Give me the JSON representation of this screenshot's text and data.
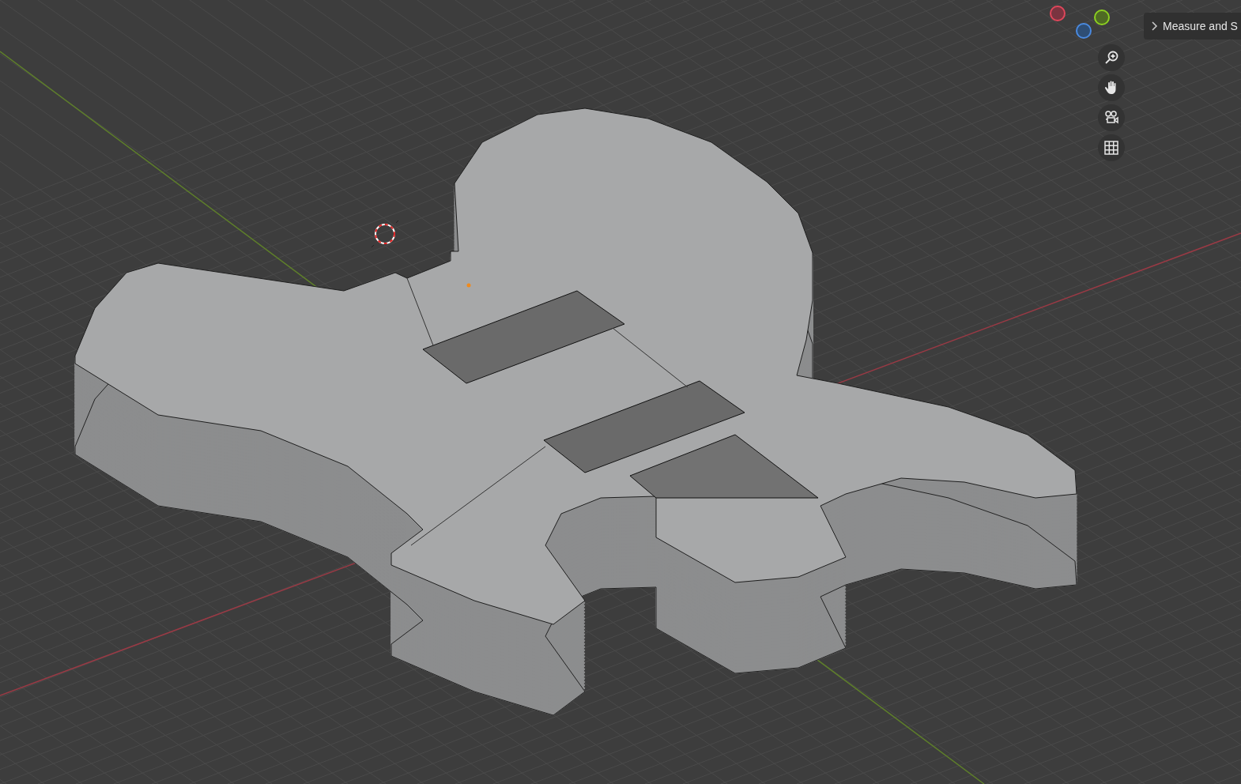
{
  "panel": {
    "title": "Measure and S",
    "expanded": false
  },
  "nav_buttons": [
    {
      "kind": "zoom"
    },
    {
      "kind": "pan"
    },
    {
      "kind": "camera"
    },
    {
      "kind": "grid"
    }
  ]
}
